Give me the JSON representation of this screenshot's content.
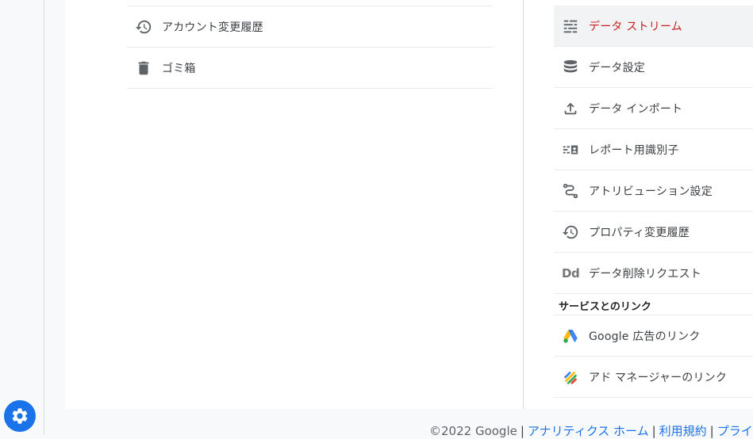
{
  "account_menu": {
    "items": [
      {
        "label": "アカウント変更履歴",
        "icon": "history-icon"
      },
      {
        "label": "ゴミ箱",
        "icon": "trash-icon"
      }
    ]
  },
  "property_menu": {
    "items": [
      {
        "label": "データ ストリーム",
        "icon": "data-streams-icon",
        "active": true
      },
      {
        "label": "データ設定",
        "icon": "database-icon"
      },
      {
        "label": "データ インポート",
        "icon": "upload-icon"
      },
      {
        "label": "レポート用識別子",
        "icon": "reporting-identity-icon"
      },
      {
        "label": "アトリビューション設定",
        "icon": "attribution-icon"
      },
      {
        "label": "プロパティ変更履歴",
        "icon": "history-icon"
      },
      {
        "label": "データ削除リクエスト",
        "icon": "dd-icon",
        "icon_text": "Dd"
      }
    ],
    "links_section": {
      "title": "サービスとのリンク",
      "items": [
        {
          "label": "Google 広告のリンク",
          "icon": "google-ads-icon"
        },
        {
          "label": "アド マネージャーのリンク",
          "icon": "ad-manager-icon"
        }
      ]
    }
  },
  "footer": {
    "copyright": "©2022 Google",
    "link_analytics_home": "アナリティクス ホーム",
    "link_terms": "利用規約",
    "link_privacy": "プライ",
    "separator": "|"
  },
  "colors": {
    "accent_blue": "#1a73e8",
    "active_red": "#c5221f",
    "icon_gray": "#5f6368"
  }
}
